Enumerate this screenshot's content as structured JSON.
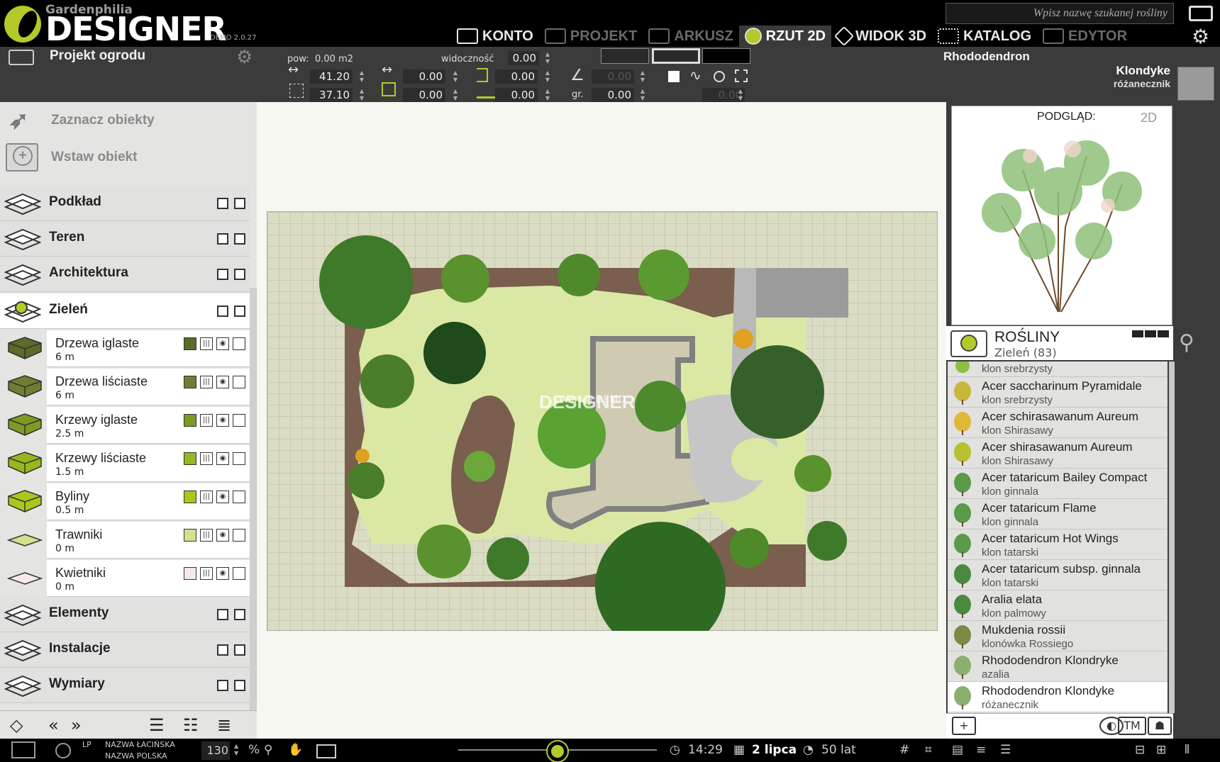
{
  "app": {
    "brand_small": "Gardenphilia",
    "brand_big": "DESIGNER",
    "version": "DEMO 2.0.27"
  },
  "nav": [
    {
      "label": "KONTO",
      "state": "normal"
    },
    {
      "label": "PROJEKT",
      "state": "dim"
    },
    {
      "label": "ARKUSZ",
      "state": "dim"
    },
    {
      "label": "RZUT 2D",
      "state": "active"
    },
    {
      "label": "WIDOK 3D",
      "state": "normal"
    },
    {
      "label": "KATALOG",
      "state": "normal"
    },
    {
      "label": "EDYTOR",
      "state": "dim"
    }
  ],
  "search": {
    "placeholder": "Wpisz nazwę szukanej rośliny"
  },
  "project": {
    "name": "Projekt ogrodu"
  },
  "toolbar": {
    "area_label": "pow:",
    "area_value": "0.00 m2",
    "visibility_label": "widoczność",
    "visibility_value": "0.00",
    "width": "41.20",
    "height": "37.10",
    "pos_x": "0.00",
    "pos_y": "0.00",
    "offset_a": "0.00",
    "offset_b": "0.00",
    "angle_a": "0.00",
    "angle_label": "gr.",
    "angle_b": "0.00",
    "extra": "0.00"
  },
  "selection": {
    "name": "Rhododendron",
    "variety": "Klondyke",
    "type": "różanecznik"
  },
  "left_tools": [
    {
      "label": "Zaznacz obiekty"
    },
    {
      "label": "Wstaw obiekt"
    }
  ],
  "layers": [
    {
      "label": "Podkład"
    },
    {
      "label": "Teren"
    },
    {
      "label": "Architektura"
    },
    {
      "label": "Zieleń"
    },
    {
      "label": "Elementy"
    },
    {
      "label": "Instalacje"
    },
    {
      "label": "Wymiary"
    }
  ],
  "sublayers": [
    {
      "label": "Drzewa iglaste",
      "height": "6 m",
      "color": "#5a6b2a"
    },
    {
      "label": "Drzewa liściaste",
      "height": "6 m",
      "color": "#6f7f30"
    },
    {
      "label": "Krzewy iglaste",
      "height": "2.5 m",
      "color": "#7d9a22"
    },
    {
      "label": "Krzewy liściaste",
      "height": "1.5 m",
      "color": "#95b81e"
    },
    {
      "label": "Byliny",
      "height": "0.5 m",
      "color": "#a8c81c"
    },
    {
      "label": "Trawniki",
      "height": "0 m",
      "color": "#d4e08c"
    },
    {
      "label": "Kwietniki",
      "height": "0 m",
      "color": "#f7e9e9"
    }
  ],
  "watermark": {
    "line1": "Wersja DEMO",
    "line2": "Gardenphilia",
    "line3": "DESIGNER"
  },
  "preview": {
    "label": "PODGLĄD:",
    "mode": "2D"
  },
  "catalog": {
    "title": "ROŚLINY",
    "subtitle": "Zieleń  (83)"
  },
  "plants": [
    {
      "name": "",
      "common": "klon srebrzysty",
      "partial": true
    },
    {
      "name": "Acer saccharinum  Pyramidale",
      "common": "klon srebrzysty",
      "thumb": "#c8b83a"
    },
    {
      "name": "Acer schirasawanum  Aureum",
      "common": "klon Shirasawy",
      "thumb": "#e0b838"
    },
    {
      "name": "Acer shirasawanum  Aureum",
      "common": "klon Shirasawy",
      "thumb": "#b8c030"
    },
    {
      "name": "Acer tataricum  Bailey Compact",
      "common": "klon ginnala",
      "thumb": "#5a9a48"
    },
    {
      "name": "Acer tataricum  Flame",
      "common": "klon ginnala",
      "thumb": "#5a9a48"
    },
    {
      "name": "Acer tataricum  Hot Wings",
      "common": "klon tatarski",
      "thumb": "#5a9a48"
    },
    {
      "name": "Acer tataricum  subsp. ginnala",
      "common": "klon tatarski",
      "thumb": "#4a8a40"
    },
    {
      "name": "Aralia elata",
      "common": "klon palmowy",
      "thumb": "#4a8a40"
    },
    {
      "name": "Mukdenia rossii",
      "common": "klonówka Rossiego",
      "thumb": "#7a8a40"
    },
    {
      "name": "Rhododendron  Klondryke",
      "common": "azalia",
      "thumb": "#8ab070"
    },
    {
      "name": "Rhododendron  Klondyke",
      "common": "różanecznik",
      "thumb": "#8ab070",
      "selected": true
    }
  ],
  "status": {
    "lp": "LP",
    "name_latin": "NAZWA ŁACIŃSKA",
    "name_polish": "NAZWA POLSKA",
    "zoom": "130",
    "zoom_unit": "%",
    "time": "14:29",
    "date": "2 lipca",
    "age": "50 lat"
  },
  "colors": {
    "accent": "#b5c92a",
    "bg_dark": "#000000",
    "toolbar": "#3b3b3b"
  }
}
